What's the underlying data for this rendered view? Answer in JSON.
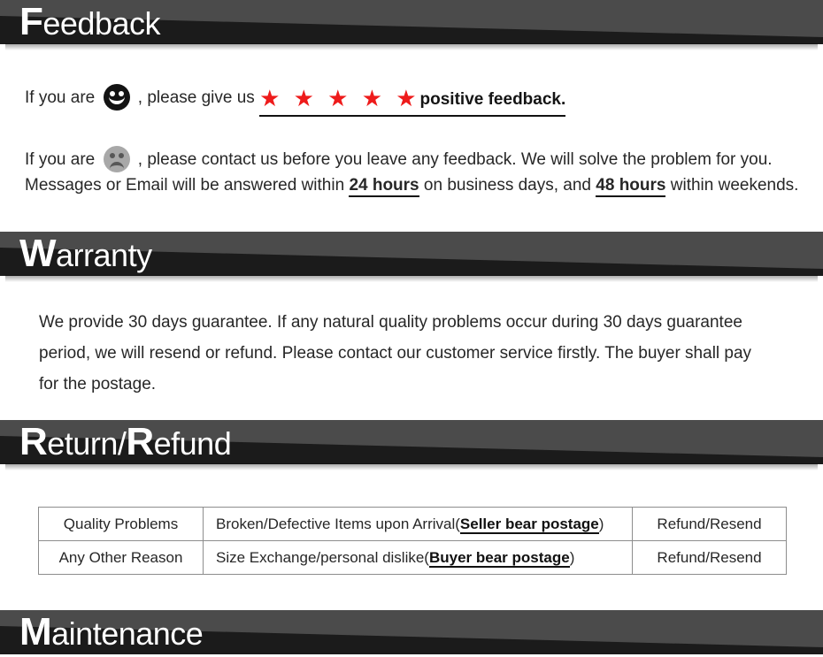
{
  "sections": {
    "feedback": {
      "banner_cap": "F",
      "banner_rest": "eedback",
      "line1_a": "If you are",
      "line1_b": ", please give us",
      "stars": "★ ★ ★ ★ ★",
      "positive": "positive feedback.",
      "line2_a": "If you are",
      "line2_b": ", please contact us before you leave any feedback. We will solve the problem for you.",
      "line3_a": "Messages or Email will be answered within",
      "line3_hours1": "24 hours",
      "line3_b": "on business days, and",
      "line3_hours2": "48 hours",
      "line3_c": "within weekends."
    },
    "warranty": {
      "banner_cap": "W",
      "banner_rest": "arranty",
      "body": "We provide 30 days guarantee. If any natural quality problems occur during 30 days guarantee period, we will resend or refund. Please contact our customer service firstly. The buyer shall pay for the postage."
    },
    "return_refund": {
      "banner_cap_1": "R",
      "banner_mid": "eturn/",
      "banner_cap_2": "R",
      "banner_rest": "efund",
      "table": {
        "rows": [
          {
            "reason": "Quality Problems",
            "desc_pre": "Broken/Defective Items upon  Arrival(",
            "desc_bold": "Seller bear postage",
            "desc_post": ")",
            "action": "Refund/Resend"
          },
          {
            "reason": "Any Other Reason",
            "desc_pre": "Size Exchange/personal dislike(",
            "desc_bold": "Buyer bear postage",
            "desc_post": ")",
            "action": "Refund/Resend"
          }
        ]
      }
    },
    "maintenance": {
      "banner_cap": "M",
      "banner_rest": "aintenance"
    }
  },
  "colors": {
    "banner_dark": "#1b1b1b",
    "banner_light": "#4b4b4b",
    "star_red": "#ee1b1b",
    "text": "#272727",
    "happy_face": "#131313",
    "sad_face": "#a8a8a8"
  }
}
